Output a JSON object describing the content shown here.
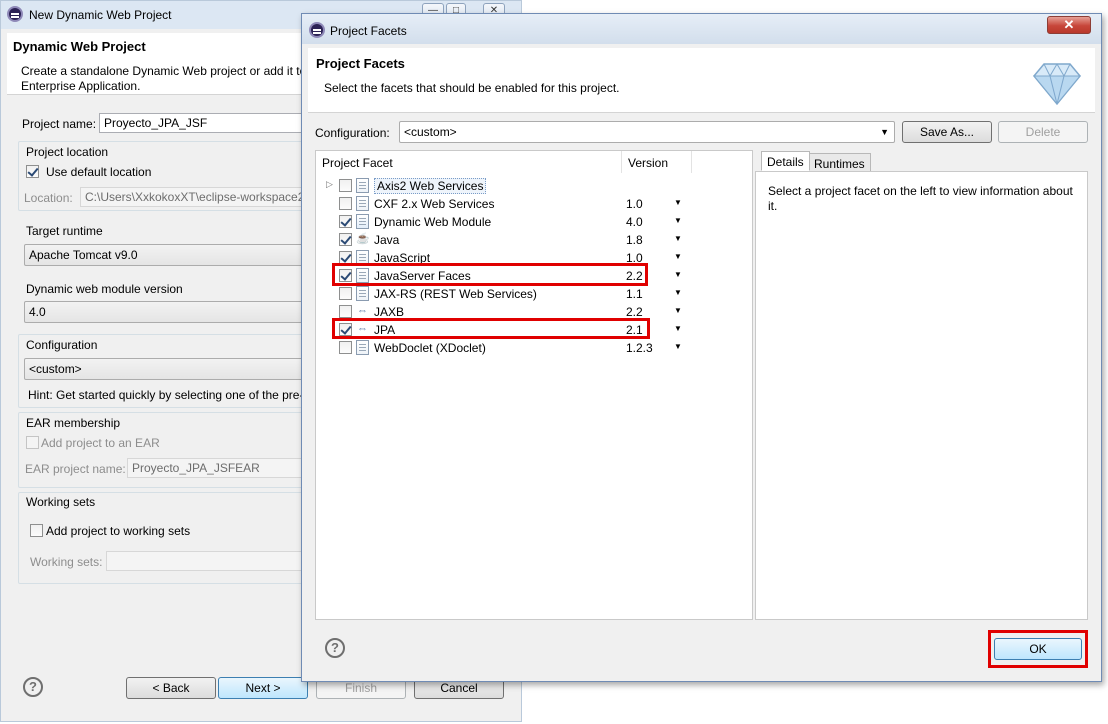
{
  "back_window": {
    "title": "New Dynamic Web Project",
    "controls": {
      "minimize": "—",
      "maximize": "□",
      "close": "✕"
    },
    "header_title": "Dynamic Web Project",
    "header_desc_line1": "Create a standalone Dynamic Web project or add it to",
    "header_desc_line2": "Enterprise Application.",
    "project_name_label": "Project name:",
    "project_name_value": "Proyecto_JPA_JSF",
    "location_group": "Project location",
    "use_default_location": "Use default location",
    "location_label": "Location:",
    "location_value": "C:\\Users\\XxkokoxXT\\eclipse-workspace2\\",
    "runtime_group": "Target runtime",
    "runtime_value": "Apache Tomcat v9.0",
    "module_version_group": "Dynamic web module version",
    "module_version_value": "4.0",
    "configuration_group": "Configuration",
    "configuration_value": "<custom>",
    "hint": "Hint: Get started quickly by selecting one of the pre-",
    "ear_group": "EAR membership",
    "add_to_ear": "Add project to an EAR",
    "ear_name_label": "EAR project name:",
    "ear_name_value": "Proyecto_JPA_JSFEAR",
    "working_sets_group": "Working sets",
    "add_working_sets": "Add project to working sets",
    "working_sets_label": "Working sets:",
    "help": "?",
    "back": "< Back",
    "next": "Next >",
    "finish": "Finish",
    "cancel": "Cancel"
  },
  "dialog": {
    "title": "Project Facets",
    "close": "✕",
    "header_title": "Project Facets",
    "header_desc": "Select the facets that should be enabled for this project.",
    "configuration_label": "Configuration:",
    "configuration_value": "<custom>",
    "save_as": "Save As...",
    "delete": "Delete",
    "col_facet": "Project Facet",
    "col_version": "Version",
    "facets": [
      {
        "name": "Axis2 Web Services",
        "version": "",
        "checked": false,
        "icon": "document-icon"
      },
      {
        "name": "CXF 2.x Web Services",
        "version": "1.0",
        "checked": false,
        "icon": "document-icon"
      },
      {
        "name": "Dynamic Web Module",
        "version": "4.0",
        "checked": true,
        "icon": "web-module-icon"
      },
      {
        "name": "Java",
        "version": "1.8",
        "checked": true,
        "icon": "java-icon"
      },
      {
        "name": "JavaScript",
        "version": "1.0",
        "checked": true,
        "icon": "document-icon"
      },
      {
        "name": "JavaServer Faces",
        "version": "2.2",
        "checked": true,
        "icon": "document-icon"
      },
      {
        "name": "JAX-RS (REST Web Services)",
        "version": "1.1",
        "checked": false,
        "icon": "document-icon"
      },
      {
        "name": "JAXB",
        "version": "2.2",
        "checked": false,
        "icon": "arrows-icon"
      },
      {
        "name": "JPA",
        "version": "2.1",
        "checked": true,
        "icon": "arrows-icon"
      },
      {
        "name": "WebDoclet (XDoclet)",
        "version": "1.2.3",
        "checked": false,
        "icon": "document-icon"
      }
    ],
    "tab_details": "Details",
    "tab_runtimes": "Runtimes",
    "details_text": "Select a project facet on the left to view information about it.",
    "help": "?",
    "ok": "OK"
  }
}
